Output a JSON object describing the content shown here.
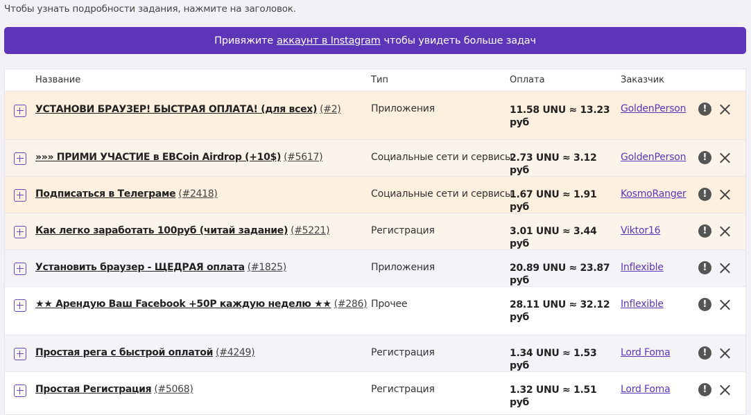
{
  "hint": "Чтобы узнать подробности задания, нажмите на заголовок.",
  "banner": {
    "before": "Привяжите",
    "link": "аккаунт в Instagram",
    "after": "чтобы увидеть больше задач"
  },
  "columns": {
    "name": "Название",
    "type": "Тип",
    "pay": "Оплата",
    "customer": "Заказчик"
  },
  "warn_glyph": "!",
  "tasks": [
    {
      "name": "УСТАНОВИ БРАУЗЕР! БЫСТРАЯ ОПЛАТА! (для всех)",
      "id": "(#2)",
      "type": "Приложения",
      "pay": "11.58 UNU ≈ 13.23 руб",
      "customer": "GoldenPerson"
    },
    {
      "name": "»»» ПРИМИ УЧАСТИЕ в EBCoin Airdrop (+10$)",
      "id": "(#5617)",
      "type": "Социальные сети и сервисы",
      "pay": "2.73 UNU ≈ 3.12 руб",
      "customer": "GoldenPerson"
    },
    {
      "name": "Подписаться в Телеграме",
      "id": "(#2418)",
      "type": "Социальные сети и сервисы",
      "pay": "1.67 UNU ≈ 1.91 руб",
      "customer": "KosmoRanger"
    },
    {
      "name": "Как легко заработать 100руб (читай задание)",
      "id": "(#5221)",
      "type": "Регистрация",
      "pay": "3.01 UNU ≈ 3.44 руб",
      "customer": "Viktor16"
    },
    {
      "name": "Установить браузер - ЩЕДРАЯ оплата",
      "id": "(#1825)",
      "type": "Приложения",
      "pay": "20.89 UNU ≈ 23.87 руб",
      "customer": "Inflexible"
    },
    {
      "name": "★★ Арендую Ваш Facebook +50Р каждую неделю ★★",
      "id": "(#286)",
      "type": "Прочее",
      "pay": "28.11 UNU ≈ 32.12 руб",
      "customer": "Inflexible"
    },
    {
      "name": "Простая рега с быстрой оплатой",
      "id": "(#4249)",
      "type": "Регистрация",
      "pay": "1.34 UNU ≈ 1.53 руб",
      "customer": "Lord Foma"
    },
    {
      "name": "Простая Регистрация",
      "id": "(#5068)",
      "type": "Регистрация",
      "pay": "1.32 UNU ≈ 1.51 руб",
      "customer": "Lord Foma"
    }
  ],
  "colors": {
    "accent": "#5d35b8",
    "highlight_row": "#fdf0df",
    "alt_row": "#f4f3f7"
  },
  "icons": {
    "expand": "plus-square-icon",
    "report": "exclamation-circle-icon",
    "hide": "close-icon"
  }
}
